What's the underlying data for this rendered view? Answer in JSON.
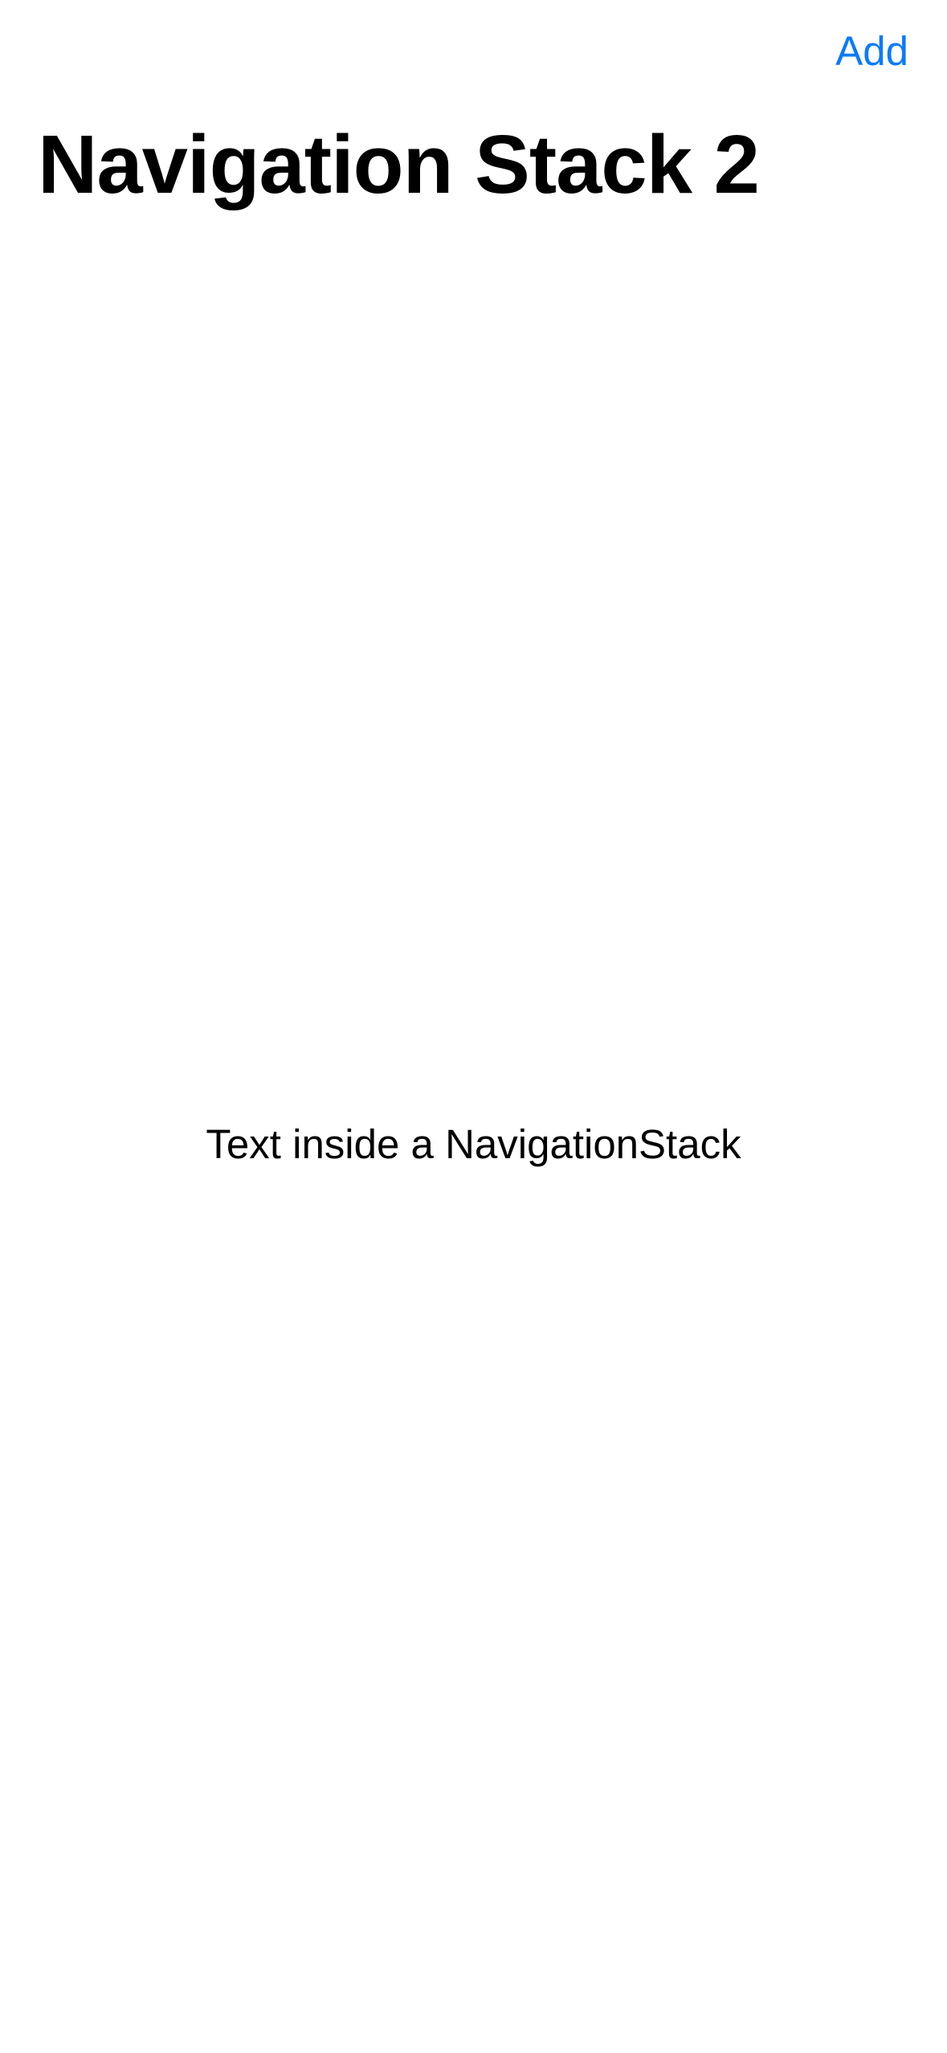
{
  "nav_bar": {
    "add_label": "Add",
    "accent_color": "#0a7aff"
  },
  "title": "Navigation Stack 2",
  "content": {
    "text": "Text inside a NavigationStack"
  }
}
